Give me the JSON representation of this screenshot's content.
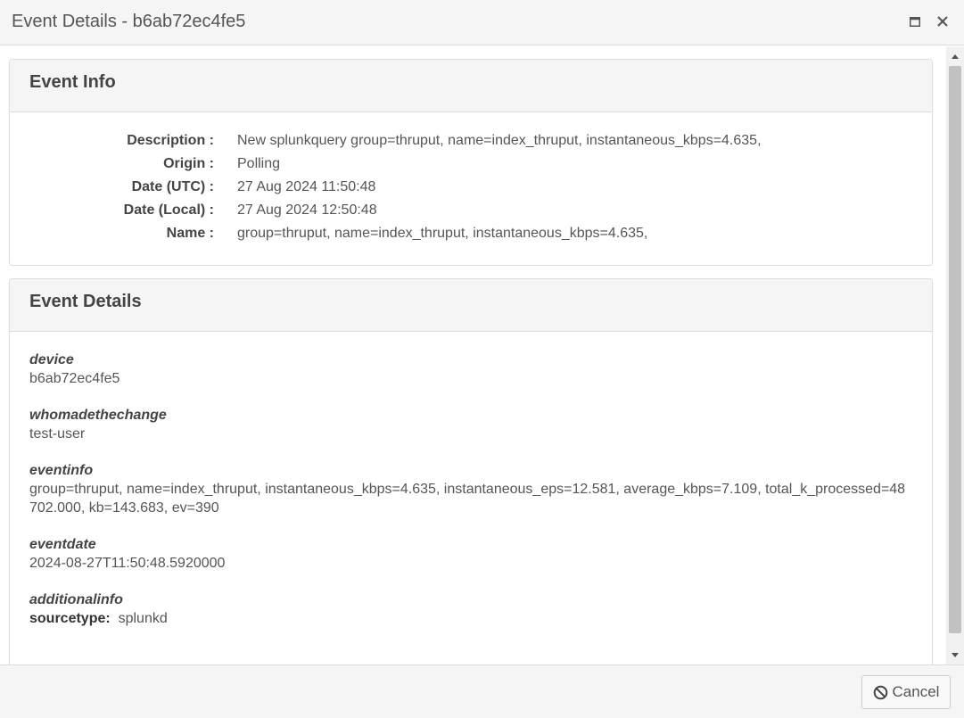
{
  "window": {
    "title": "Event Details - b6ab72ec4fe5"
  },
  "event_info": {
    "heading": "Event Info",
    "rows": [
      {
        "label": "Description :",
        "value": "New splunkquery group=thruput, name=index_thruput, instantaneous_kbps=4.635,"
      },
      {
        "label": "Origin :",
        "value": "Polling"
      },
      {
        "label": "Date (UTC) :",
        "value": "27 Aug 2024 11:50:48"
      },
      {
        "label": "Date (Local) :",
        "value": "27 Aug 2024 12:50:48"
      },
      {
        "label": "Name :",
        "value": "group=thruput, name=index_thruput, instantaneous_kbps=4.635,"
      }
    ]
  },
  "event_details": {
    "heading": "Event Details",
    "items": [
      {
        "key": "device",
        "value": "b6ab72ec4fe5"
      },
      {
        "key": "whomadethechange",
        "value": "test-user"
      },
      {
        "key": "eventinfo",
        "value": "group=thruput, name=index_thruput, instantaneous_kbps=4.635, instantaneous_eps=12.581, average_kbps=7.109, total_k_processed=48702.000, kb=143.683, ev=390"
      },
      {
        "key": "eventdate",
        "value": "2024-08-27T11:50:48.5920000"
      },
      {
        "key": "additionalinfo",
        "sub_label": "sourcetype:",
        "sub_value": "splunkd"
      }
    ]
  },
  "footer": {
    "cancel_label": "Cancel"
  },
  "icons": {
    "maximize": "maximize-icon",
    "close": "close-icon",
    "cancel": "ban-icon"
  }
}
